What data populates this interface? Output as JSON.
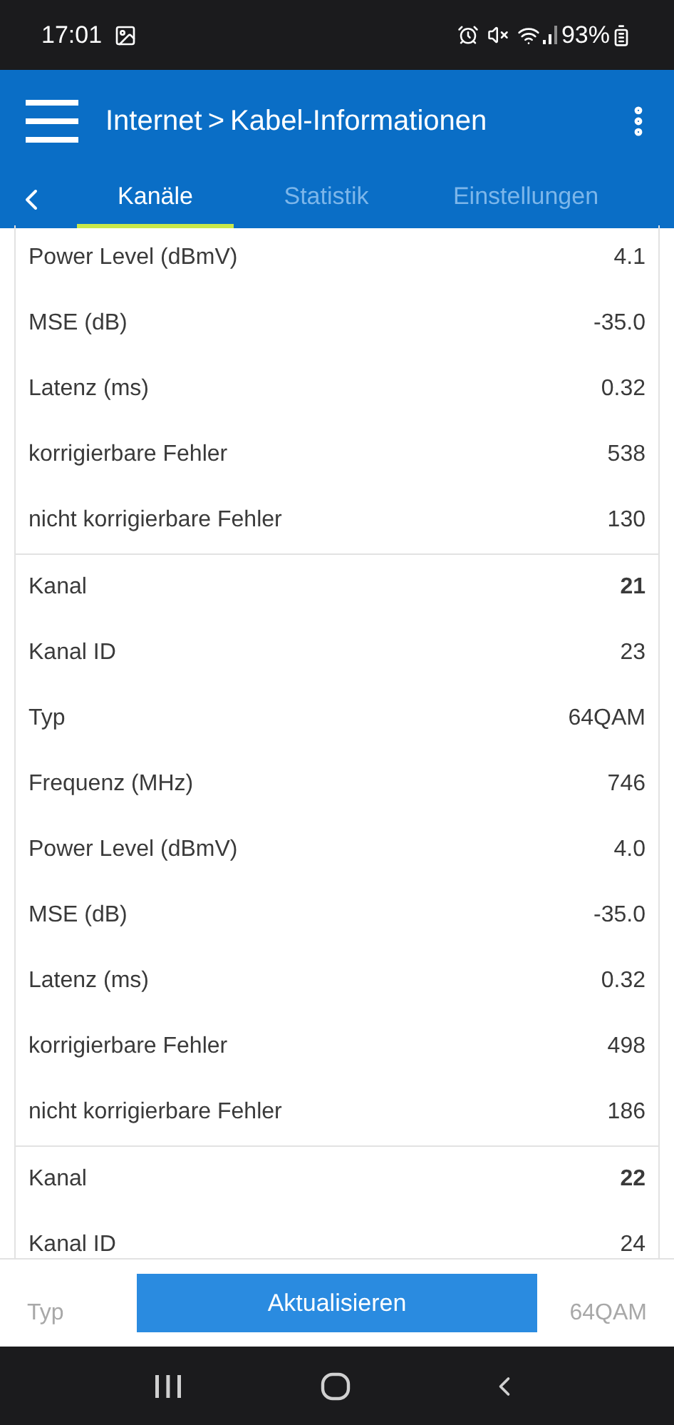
{
  "status_bar": {
    "time": "17:01",
    "battery": "93%"
  },
  "header": {
    "breadcrumb_parent": "Internet",
    "breadcrumb_separator": ">",
    "title": "Kabel-Informationen"
  },
  "tabs": [
    {
      "label": "Kanäle",
      "selected": true
    },
    {
      "label": "Statistik",
      "selected": false
    },
    {
      "label": "Einstellungen",
      "selected": false
    }
  ],
  "groups": [
    {
      "rows": [
        {
          "label": "Power Level (dBmV)",
          "value": "4.1",
          "bold": false
        },
        {
          "label": "MSE (dB)",
          "value": "-35.0",
          "bold": false
        },
        {
          "label": "Latenz (ms)",
          "value": "0.32",
          "bold": false
        },
        {
          "label": "korrigierbare Fehler",
          "value": "538",
          "bold": false
        },
        {
          "label": "nicht korrigierbare Fehler",
          "value": "130",
          "bold": false
        }
      ]
    },
    {
      "rows": [
        {
          "label": "Kanal",
          "value": "21",
          "bold": true
        },
        {
          "label": "Kanal ID",
          "value": "23",
          "bold": false
        },
        {
          "label": "Typ",
          "value": "64QAM",
          "bold": false
        },
        {
          "label": "Frequenz (MHz)",
          "value": "746",
          "bold": false
        },
        {
          "label": "Power Level (dBmV)",
          "value": "4.0",
          "bold": false
        },
        {
          "label": "MSE (dB)",
          "value": "-35.0",
          "bold": false
        },
        {
          "label": "Latenz (ms)",
          "value": "0.32",
          "bold": false
        },
        {
          "label": "korrigierbare Fehler",
          "value": "498",
          "bold": false
        },
        {
          "label": "nicht korrigierbare Fehler",
          "value": "186",
          "bold": false
        }
      ]
    },
    {
      "rows": [
        {
          "label": "Kanal",
          "value": "22",
          "bold": true
        },
        {
          "label": "Kanal ID",
          "value": "24",
          "bold": false
        }
      ]
    }
  ],
  "faded_row": {
    "label": "Typ",
    "value": "64QAM"
  },
  "refresh_button": "Aktualisieren"
}
